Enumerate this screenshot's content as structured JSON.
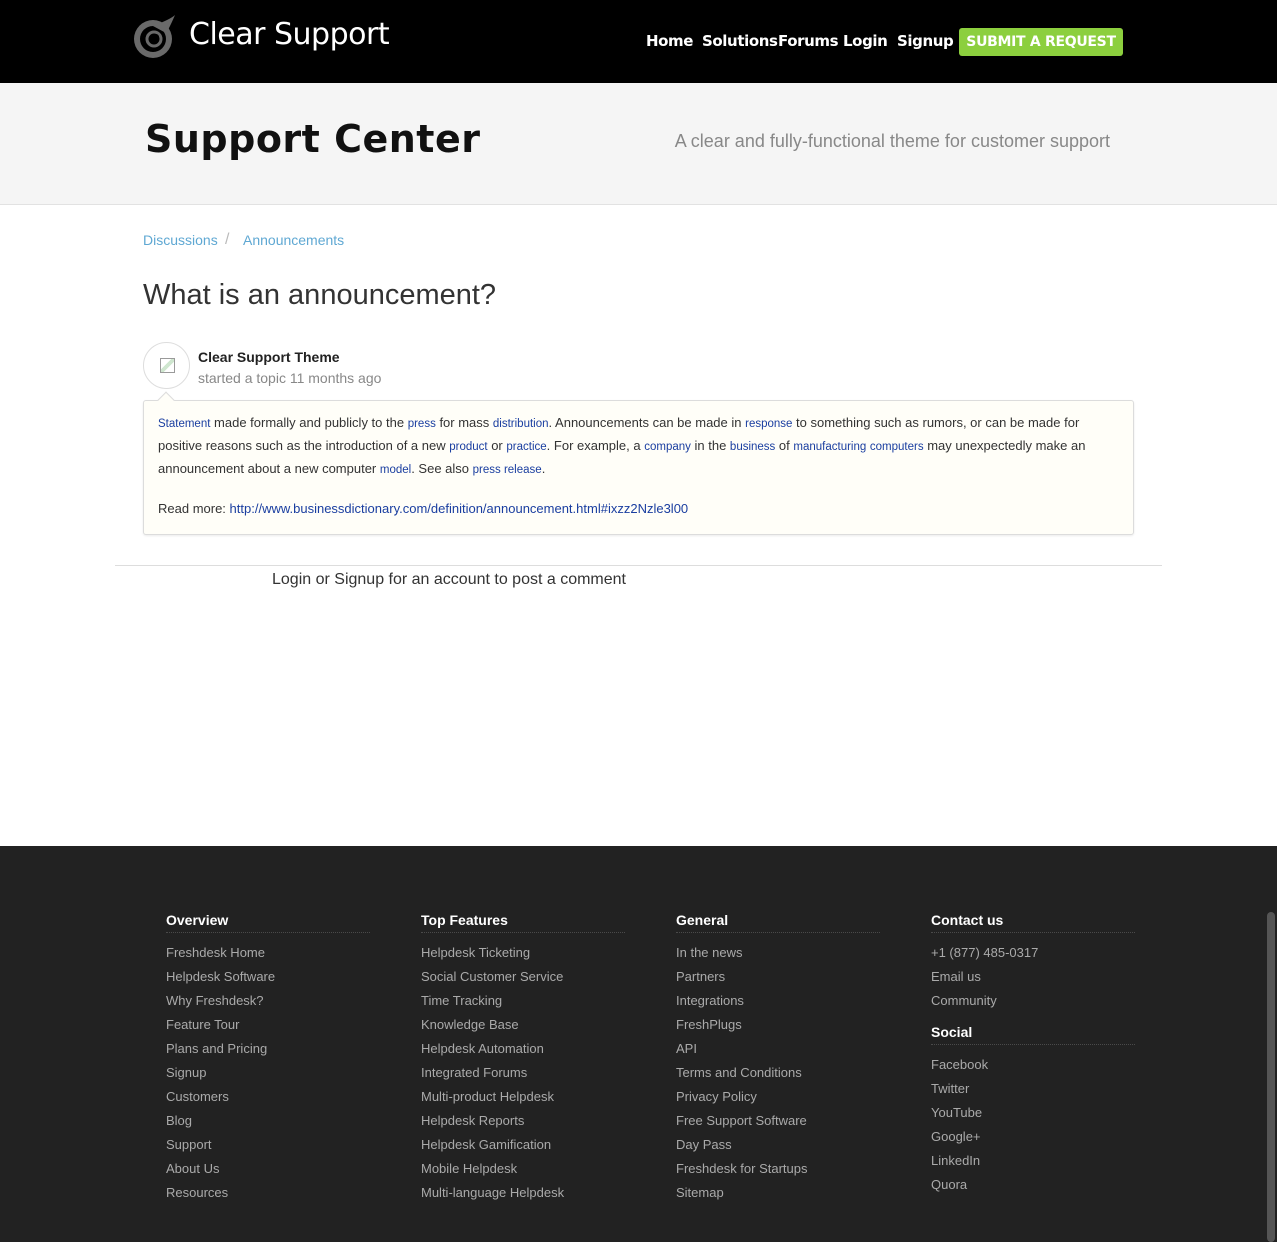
{
  "brand": {
    "name": "Clear Support"
  },
  "nav": {
    "items": [
      "Home",
      "Solutions",
      "Forums",
      "Login",
      "Signup"
    ],
    "submit_label": "SUBMIT A REQUEST"
  },
  "header": {
    "title": "Support Center",
    "tagline": "A clear and fully-functional theme for customer support"
  },
  "breadcrumb": {
    "items": [
      "Discussions",
      "Announcements"
    ],
    "separator": "/"
  },
  "topic": {
    "title": "What is an announcement?",
    "author": "Clear Support Theme",
    "meta": "started a topic 11 months ago"
  },
  "post": {
    "segments": [
      {
        "t": "Statement",
        "link": true
      },
      {
        "t": " made formally and publicly to the ",
        "link": false
      },
      {
        "t": "press",
        "link": true
      },
      {
        "t": " for mass ",
        "link": false
      },
      {
        "t": "distribution",
        "link": true
      },
      {
        "t": ". Announcements can be made in ",
        "link": false
      },
      {
        "t": "response",
        "link": true
      },
      {
        "t": " to something such as rumors, or can be made for positive reasons such as the introduction of a new ",
        "link": false
      },
      {
        "t": "product",
        "link": true
      },
      {
        "t": " or ",
        "link": false
      },
      {
        "t": "practice",
        "link": true
      },
      {
        "t": ". For example, a ",
        "link": false
      },
      {
        "t": "company",
        "link": true
      },
      {
        "t": " in the ",
        "link": false
      },
      {
        "t": "business",
        "link": true
      },
      {
        "t": " of ",
        "link": false
      },
      {
        "t": "manufacturing",
        "link": true
      },
      {
        "t": " ",
        "link": false
      },
      {
        "t": "computers",
        "link": true
      },
      {
        "t": " may unexpectedly make an announcement about a new computer ",
        "link": false
      },
      {
        "t": "model",
        "link": true
      },
      {
        "t": ". See also ",
        "link": false
      },
      {
        "t": "press release",
        "link": true
      },
      {
        "t": ".",
        "link": false
      }
    ],
    "readmore_label": "Read more:",
    "readmore_url": "http://www.businessdictionary.com/definition/announcement.html#ixzz2Nzle3l00"
  },
  "comment_note": "Login or Signup for an account to post a comment",
  "footer": {
    "overview": {
      "title": "Overview",
      "items": [
        "Freshdesk Home",
        "Helpdesk Software",
        "Why Freshdesk?",
        "Feature Tour",
        "Plans and Pricing",
        "Signup",
        "Customers",
        "Blog",
        "Support",
        "About Us",
        "Resources"
      ]
    },
    "features": {
      "title": "Top Features",
      "items": [
        "Helpdesk Ticketing",
        "Social Customer Service",
        "Time Tracking",
        "Knowledge Base",
        "Helpdesk Automation",
        "Integrated Forums",
        "Multi-product Helpdesk",
        "Helpdesk Reports",
        "Helpdesk Gamification",
        "Mobile Helpdesk",
        "Multi-language Helpdesk"
      ]
    },
    "general": {
      "title": "General",
      "items": [
        "In the news",
        "Partners",
        "Integrations",
        "FreshPlugs",
        "API",
        "Terms and Conditions",
        "Privacy Policy",
        "Free Support Software",
        "Day Pass",
        "Freshdesk for Startups",
        "Sitemap"
      ]
    },
    "contact": {
      "title": "Contact us",
      "items": [
        "+1 (877) 485-0317",
        "Email us",
        "Community"
      ]
    },
    "social": {
      "title": "Social",
      "items": [
        "Facebook",
        "Twitter",
        "YouTube",
        "Google+",
        "LinkedIn",
        "Quora"
      ]
    }
  },
  "colors": {
    "accent_green": "#8ccf3e",
    "link_blue": "#1a3ea0",
    "breadcrumb_blue": "#5fa8d3",
    "footer_bg": "#222222"
  }
}
